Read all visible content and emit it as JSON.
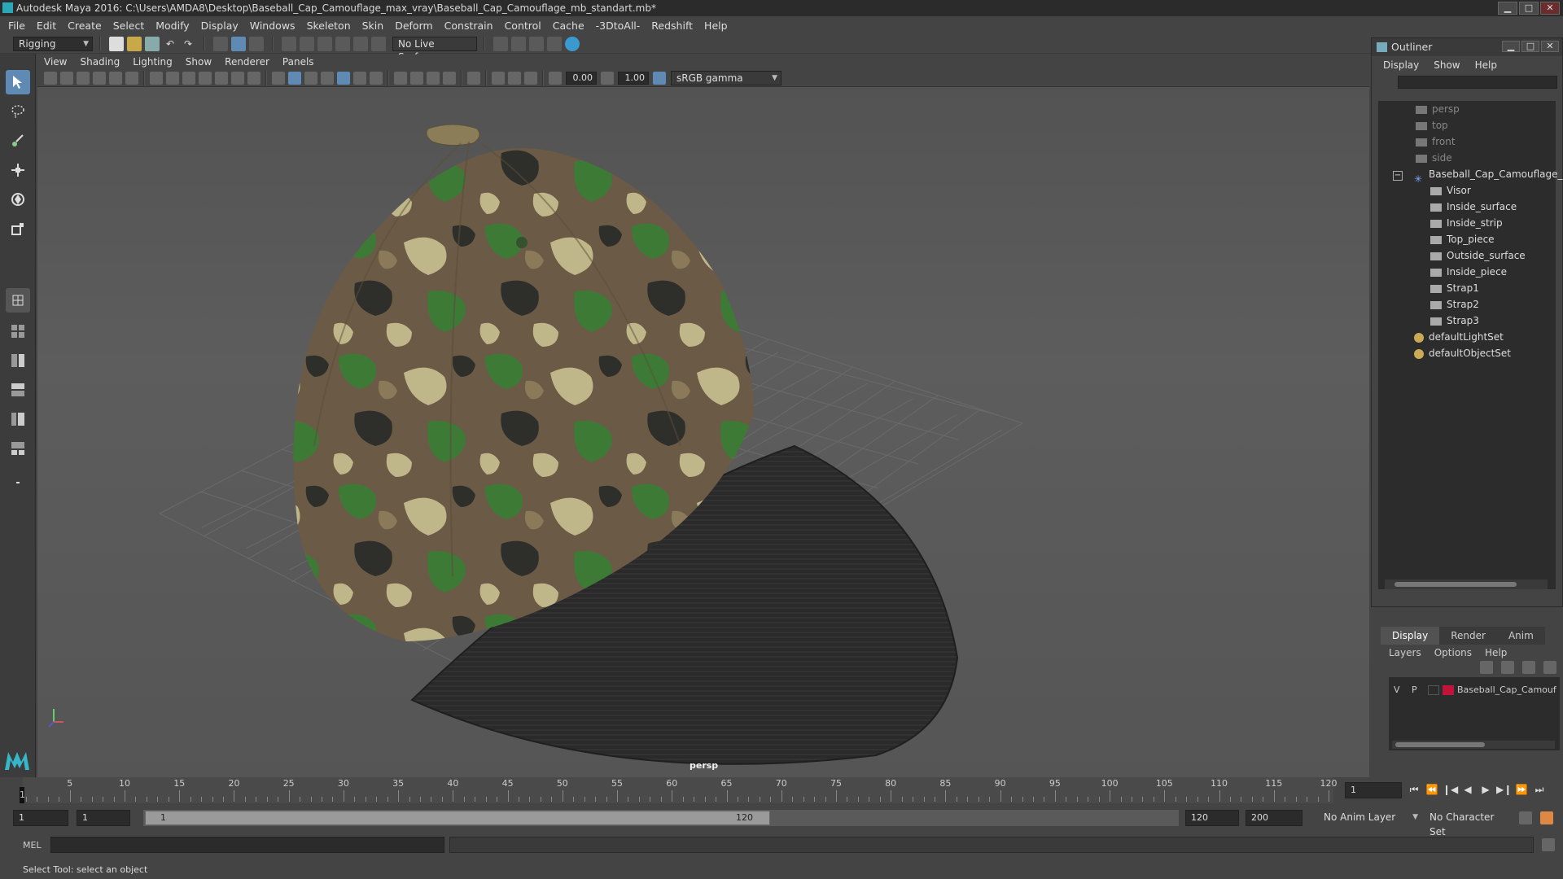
{
  "window": {
    "title": "Autodesk Maya 2016: C:\\Users\\AMDA8\\Desktop\\Baseball_Cap_Camouflage_max_vray\\Baseball_Cap_Camouflage_mb_standart.mb*",
    "minimize": "▁",
    "maximize": "□",
    "close": "✕"
  },
  "menubar": [
    "File",
    "Edit",
    "Create",
    "Select",
    "Modify",
    "Display",
    "Windows",
    "Skeleton",
    "Skin",
    "Deform",
    "Constrain",
    "Control",
    "Cache",
    "-3DtoAll-",
    "Redshift",
    "Help"
  ],
  "statusline": {
    "menuset": "Rigging",
    "live_surface": "No Live Surface"
  },
  "viewport": {
    "menu": [
      "View",
      "Shading",
      "Lighting",
      "Show",
      "Renderer",
      "Panels"
    ],
    "exposure": "0.00",
    "gamma": "1.00",
    "colorspace": "sRGB gamma",
    "camera_label": "persp"
  },
  "outliner": {
    "title": "Outliner",
    "menu": [
      "Display",
      "Show",
      "Help"
    ],
    "items": [
      {
        "label": "persp",
        "type": "camera"
      },
      {
        "label": "top",
        "type": "camera"
      },
      {
        "label": "front",
        "type": "camera"
      },
      {
        "label": "side",
        "type": "camera"
      },
      {
        "label": "Baseball_Cap_Camouflage_r",
        "type": "group"
      },
      {
        "label": "Visor",
        "type": "mesh"
      },
      {
        "label": "Inside_surface",
        "type": "mesh"
      },
      {
        "label": "Inside_strip",
        "type": "mesh"
      },
      {
        "label": "Top_piece",
        "type": "mesh"
      },
      {
        "label": "Outside_surface",
        "type": "mesh"
      },
      {
        "label": "Inside_piece",
        "type": "mesh"
      },
      {
        "label": "Strap1",
        "type": "mesh"
      },
      {
        "label": "Strap2",
        "type": "mesh"
      },
      {
        "label": "Strap3",
        "type": "mesh"
      },
      {
        "label": "defaultLightSet",
        "type": "set"
      },
      {
        "label": "defaultObjectSet",
        "type": "set"
      }
    ]
  },
  "layers": {
    "tabs": [
      "Display",
      "Render",
      "Anim"
    ],
    "menu": [
      "Layers",
      "Options",
      "Help"
    ],
    "layer": {
      "v": "V",
      "p": "P",
      "name": "Baseball_Cap_Camouf",
      "color": "#c0143c"
    }
  },
  "timeline": {
    "ticks": [
      "5",
      "10",
      "15",
      "20",
      "25",
      "30",
      "35",
      "40",
      "45",
      "50",
      "55",
      "60",
      "65",
      "70",
      "75",
      "80",
      "85",
      "90",
      "95",
      "100",
      "105",
      "110",
      "115",
      "120"
    ],
    "current_frame": "1",
    "current_field": "1"
  },
  "range": {
    "start": "1",
    "playback_start": "1",
    "slider_start": "1",
    "slider_end": "120",
    "playback_end": "120",
    "end": "200",
    "anim_layer": "No Anim Layer",
    "character_set": "No Character Set"
  },
  "cmdline": {
    "label": "MEL"
  },
  "helpline": {
    "text": "Select Tool: select an object"
  }
}
